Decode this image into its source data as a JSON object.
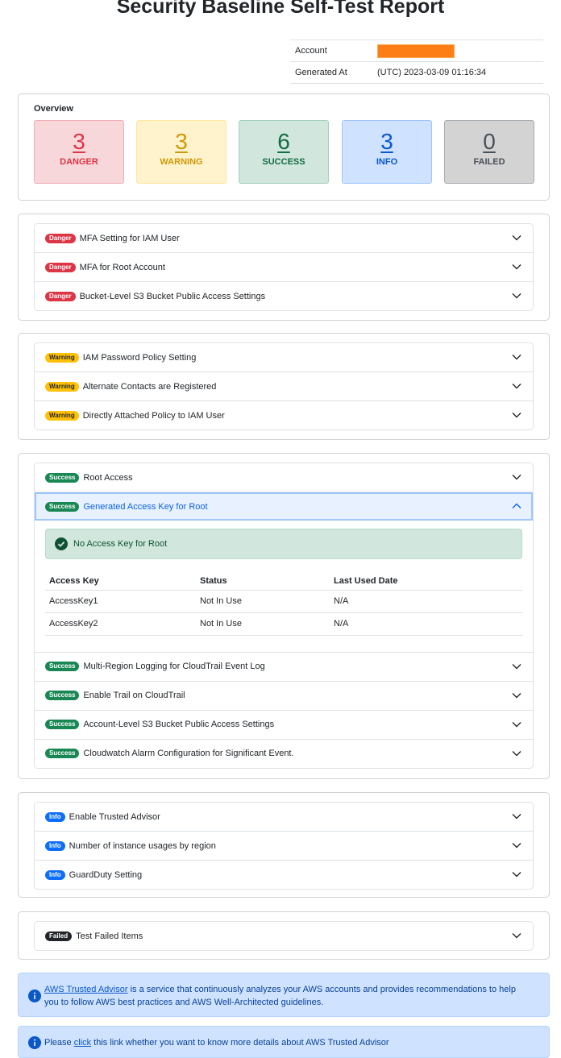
{
  "header": {
    "title": "Security Baseline Self-Test Report",
    "account_label": "Account",
    "generated_label": "Generated At",
    "generated_value": "(UTC) 2023-03-09 01:16:34"
  },
  "overview": {
    "title": "Overview",
    "stats": [
      {
        "count": "3",
        "label": "DANGER",
        "bg": "#f8d7da",
        "border": "#f1aeb5",
        "color": "#dc3545"
      },
      {
        "count": "3",
        "label": "WARNING",
        "bg": "#fff3cd",
        "border": "#ffe69c",
        "color": "#cc9a06"
      },
      {
        "count": "6",
        "label": "SUCCESS",
        "bg": "#d1e7dd",
        "border": "#a3cfbb",
        "color": "#146c43"
      },
      {
        "count": "3",
        "label": "INFO",
        "bg": "#cfe2ff",
        "border": "#9ec5fe",
        "color": "#0a58ca"
      },
      {
        "count": "0",
        "label": "FAILED",
        "bg": "#d3d3d4",
        "border": "#a7acb1",
        "color": "#495057"
      }
    ]
  },
  "danger": {
    "badge": "Danger",
    "items": [
      "MFA Setting for IAM User",
      "MFA for Root Account",
      "Bucket-Level S3 Bucket Public Access Settings"
    ]
  },
  "warning": {
    "badge": "Warning",
    "items": [
      "IAM Password Policy Setting",
      "Alternate Contacts are Registered",
      "Directly Attached Policy to IAM User"
    ]
  },
  "success": {
    "badge": "Success",
    "items": [
      "Root Access",
      "Generated Access Key for Root",
      "Multi-Region Logging for CloudTrail Event Log",
      "Enable Trail on CloudTrail",
      "Account-Level S3 Bucket Public Access Settings",
      "Cloudwatch Alarm Configuration for Significant Event."
    ],
    "expanded": {
      "alert": "No Access Key for Root",
      "columns": [
        "Access Key",
        "Status",
        "Last Used Date"
      ],
      "rows": [
        [
          "AccessKey1",
          "Not In Use",
          "N/A"
        ],
        [
          "AccessKey2",
          "Not In Use",
          "N/A"
        ]
      ]
    }
  },
  "info": {
    "badge": "Info",
    "items": [
      "Enable Trusted Advisor",
      "Number of instance usages by region",
      "GuardDuty Setting"
    ]
  },
  "failed": {
    "badge": "Failed",
    "items": [
      "Test Failed Items"
    ]
  },
  "notes": {
    "trusted_advisor_link": "AWS Trusted Advisor",
    "trusted_advisor_text_1": " is a service that continuously analyzes your AWS accounts and provides recommendations to help",
    "trusted_advisor_text_2": "you to follow AWS best practices and AWS Well-Architected guidelines.",
    "click_prefix": "Please ",
    "click_link": "click",
    "click_suffix": " this link whether you want to know more details about AWS Trusted Advisor"
  }
}
